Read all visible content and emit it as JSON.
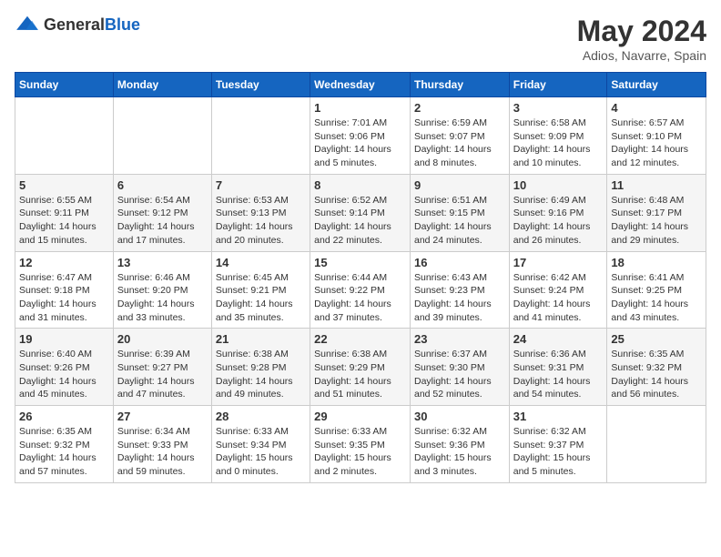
{
  "header": {
    "logo_general": "General",
    "logo_blue": "Blue",
    "title": "May 2024",
    "subtitle": "Adios, Navarre, Spain"
  },
  "days_of_week": [
    "Sunday",
    "Monday",
    "Tuesday",
    "Wednesday",
    "Thursday",
    "Friday",
    "Saturday"
  ],
  "weeks": [
    [
      {
        "num": "",
        "info": ""
      },
      {
        "num": "",
        "info": ""
      },
      {
        "num": "",
        "info": ""
      },
      {
        "num": "1",
        "info": "Sunrise: 7:01 AM\nSunset: 9:06 PM\nDaylight: 14 hours\nand 5 minutes."
      },
      {
        "num": "2",
        "info": "Sunrise: 6:59 AM\nSunset: 9:07 PM\nDaylight: 14 hours\nand 8 minutes."
      },
      {
        "num": "3",
        "info": "Sunrise: 6:58 AM\nSunset: 9:09 PM\nDaylight: 14 hours\nand 10 minutes."
      },
      {
        "num": "4",
        "info": "Sunrise: 6:57 AM\nSunset: 9:10 PM\nDaylight: 14 hours\nand 12 minutes."
      }
    ],
    [
      {
        "num": "5",
        "info": "Sunrise: 6:55 AM\nSunset: 9:11 PM\nDaylight: 14 hours\nand 15 minutes."
      },
      {
        "num": "6",
        "info": "Sunrise: 6:54 AM\nSunset: 9:12 PM\nDaylight: 14 hours\nand 17 minutes."
      },
      {
        "num": "7",
        "info": "Sunrise: 6:53 AM\nSunset: 9:13 PM\nDaylight: 14 hours\nand 20 minutes."
      },
      {
        "num": "8",
        "info": "Sunrise: 6:52 AM\nSunset: 9:14 PM\nDaylight: 14 hours\nand 22 minutes."
      },
      {
        "num": "9",
        "info": "Sunrise: 6:51 AM\nSunset: 9:15 PM\nDaylight: 14 hours\nand 24 minutes."
      },
      {
        "num": "10",
        "info": "Sunrise: 6:49 AM\nSunset: 9:16 PM\nDaylight: 14 hours\nand 26 minutes."
      },
      {
        "num": "11",
        "info": "Sunrise: 6:48 AM\nSunset: 9:17 PM\nDaylight: 14 hours\nand 29 minutes."
      }
    ],
    [
      {
        "num": "12",
        "info": "Sunrise: 6:47 AM\nSunset: 9:18 PM\nDaylight: 14 hours\nand 31 minutes."
      },
      {
        "num": "13",
        "info": "Sunrise: 6:46 AM\nSunset: 9:20 PM\nDaylight: 14 hours\nand 33 minutes."
      },
      {
        "num": "14",
        "info": "Sunrise: 6:45 AM\nSunset: 9:21 PM\nDaylight: 14 hours\nand 35 minutes."
      },
      {
        "num": "15",
        "info": "Sunrise: 6:44 AM\nSunset: 9:22 PM\nDaylight: 14 hours\nand 37 minutes."
      },
      {
        "num": "16",
        "info": "Sunrise: 6:43 AM\nSunset: 9:23 PM\nDaylight: 14 hours\nand 39 minutes."
      },
      {
        "num": "17",
        "info": "Sunrise: 6:42 AM\nSunset: 9:24 PM\nDaylight: 14 hours\nand 41 minutes."
      },
      {
        "num": "18",
        "info": "Sunrise: 6:41 AM\nSunset: 9:25 PM\nDaylight: 14 hours\nand 43 minutes."
      }
    ],
    [
      {
        "num": "19",
        "info": "Sunrise: 6:40 AM\nSunset: 9:26 PM\nDaylight: 14 hours\nand 45 minutes."
      },
      {
        "num": "20",
        "info": "Sunrise: 6:39 AM\nSunset: 9:27 PM\nDaylight: 14 hours\nand 47 minutes."
      },
      {
        "num": "21",
        "info": "Sunrise: 6:38 AM\nSunset: 9:28 PM\nDaylight: 14 hours\nand 49 minutes."
      },
      {
        "num": "22",
        "info": "Sunrise: 6:38 AM\nSunset: 9:29 PM\nDaylight: 14 hours\nand 51 minutes."
      },
      {
        "num": "23",
        "info": "Sunrise: 6:37 AM\nSunset: 9:30 PM\nDaylight: 14 hours\nand 52 minutes."
      },
      {
        "num": "24",
        "info": "Sunrise: 6:36 AM\nSunset: 9:31 PM\nDaylight: 14 hours\nand 54 minutes."
      },
      {
        "num": "25",
        "info": "Sunrise: 6:35 AM\nSunset: 9:32 PM\nDaylight: 14 hours\nand 56 minutes."
      }
    ],
    [
      {
        "num": "26",
        "info": "Sunrise: 6:35 AM\nSunset: 9:32 PM\nDaylight: 14 hours\nand 57 minutes."
      },
      {
        "num": "27",
        "info": "Sunrise: 6:34 AM\nSunset: 9:33 PM\nDaylight: 14 hours\nand 59 minutes."
      },
      {
        "num": "28",
        "info": "Sunrise: 6:33 AM\nSunset: 9:34 PM\nDaylight: 15 hours\nand 0 minutes."
      },
      {
        "num": "29",
        "info": "Sunrise: 6:33 AM\nSunset: 9:35 PM\nDaylight: 15 hours\nand 2 minutes."
      },
      {
        "num": "30",
        "info": "Sunrise: 6:32 AM\nSunset: 9:36 PM\nDaylight: 15 hours\nand 3 minutes."
      },
      {
        "num": "31",
        "info": "Sunrise: 6:32 AM\nSunset: 9:37 PM\nDaylight: 15 hours\nand 5 minutes."
      },
      {
        "num": "",
        "info": ""
      }
    ]
  ]
}
